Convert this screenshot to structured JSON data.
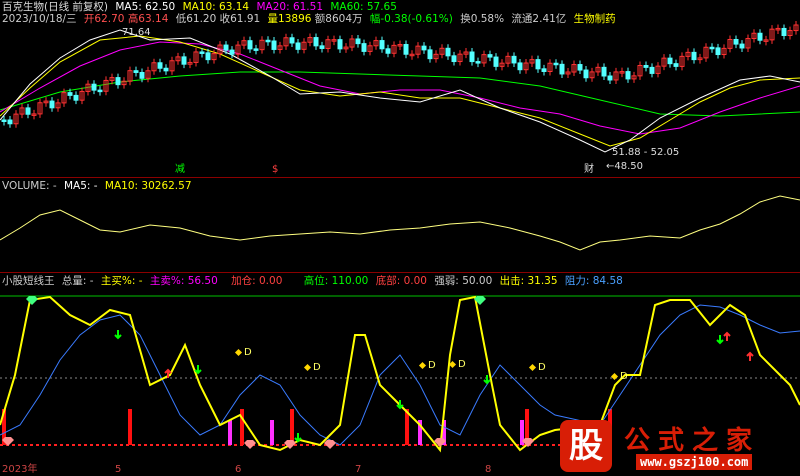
{
  "main": {
    "title": "百克生物(日线 前复权)",
    "ma5": "MA5: 62.50",
    "ma10": "MA10: 63.14",
    "ma20": "MA20: 61.51",
    "ma60": "MA60: 57.65",
    "date": "2023/10/18/三",
    "open": "开62.70",
    "high": "高63.14",
    "low": "低61.20",
    "close": "收61.91",
    "vol": "量13896",
    "amount": "额8604万",
    "change": "幅-0.38(-0.61%)",
    "turnover": "换0.58%",
    "float": "流通2.41亿",
    "industry": "生物制药",
    "high_mark": "71.64",
    "range_mark": "51.88 - 52.05",
    "low_mark": "←48.50",
    "signal_buy": "减",
    "signal_sell": "$",
    "signal_fin": "财"
  },
  "volume": {
    "label": "VOLUME: -",
    "ma5": "MA5: -",
    "ma10": "MA10: 30262.57"
  },
  "indicator": {
    "name": "小股短线王",
    "total": "总量: -",
    "buy": "主买%: -",
    "sell": "主卖%: 56.50",
    "add": "加仓: 0.00",
    "highpos": "高位: 110.00",
    "bottom": "底部: 0.00",
    "strength": "强弱: 50.00",
    "exit": "出击: 31.35",
    "resist": "阻力: 84.58",
    "d_label": "D"
  },
  "dates": [
    "2023年",
    "5",
    "6",
    "7",
    "8"
  ],
  "logo": {
    "glyph": "股",
    "title": "公式之家",
    "url": "www.gszj100.com"
  },
  "colors": {
    "ma5": "#ffffff",
    "ma10": "#ffff00",
    "ma20": "#ff00ff",
    "ma60": "#00ff00",
    "up": "#ff3232",
    "down": "#54ffff",
    "separator": "#8b0000"
  }
}
